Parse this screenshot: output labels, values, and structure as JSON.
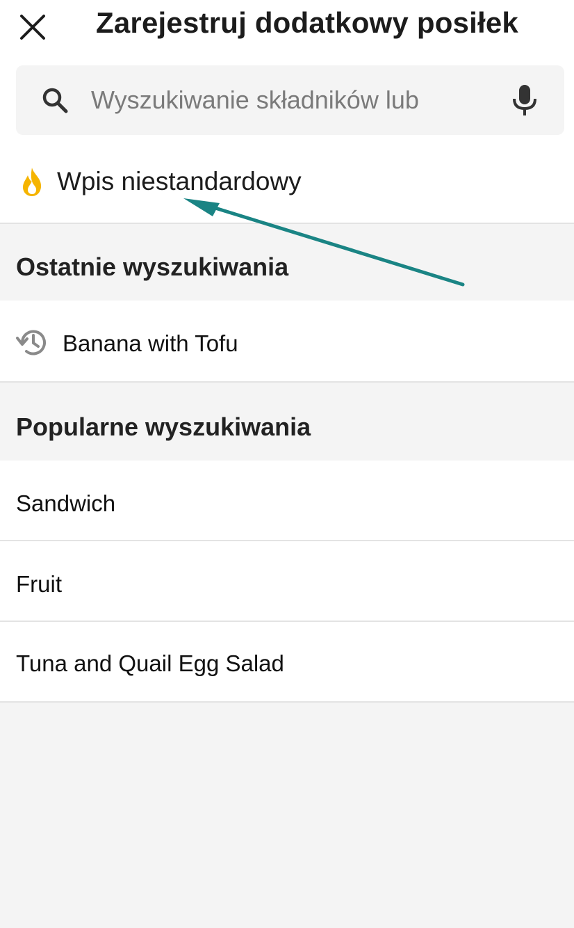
{
  "header": {
    "title": "Zarejestruj dodatkowy posiłek",
    "close_icon": "close-icon"
  },
  "search": {
    "placeholder": "Wyszukiwanie składników lub",
    "value": "",
    "search_icon": "search-icon",
    "mic_icon": "microphone-icon"
  },
  "custom_entry": {
    "label": "Wpis niestandardowy",
    "icon": "flame-icon",
    "icon_color": "#f5b400"
  },
  "recent": {
    "title": "Ostatnie wyszukiwania",
    "items": [
      {
        "label": "Banana with Tofu",
        "icon": "history-icon"
      }
    ]
  },
  "popular": {
    "title": "Popularne wyszukiwania",
    "items": [
      {
        "label": "Sandwich"
      },
      {
        "label": "Fruit"
      },
      {
        "label": "Tuna and Quail Egg Salad"
      }
    ]
  },
  "annotation": {
    "arrow_color": "#1a8484",
    "arrow_icon": "annotation-arrow"
  }
}
